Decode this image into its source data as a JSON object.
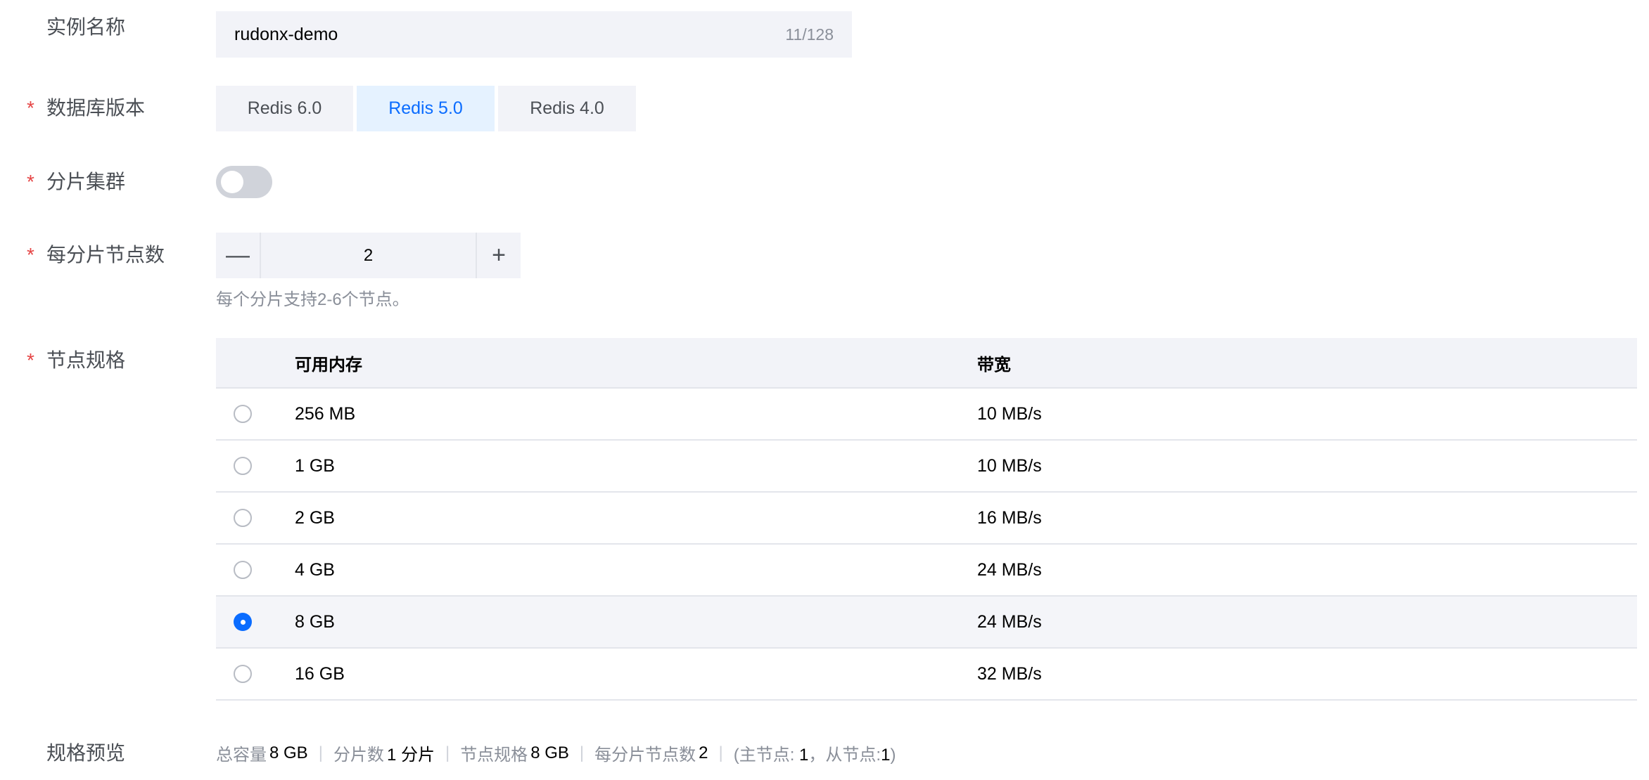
{
  "instance_name": {
    "label": "实例名称",
    "value": "rudonx-demo",
    "count": "11/128"
  },
  "db_version": {
    "label": "数据库版本",
    "options": [
      "Redis 6.0",
      "Redis 5.0",
      "Redis 4.0"
    ],
    "selected": "Redis 5.0"
  },
  "sharding": {
    "label": "分片集群",
    "enabled": false
  },
  "nodes_per_shard": {
    "label": "每分片节点数",
    "minus": "—",
    "plus": "+",
    "value": "2",
    "help": "每个分片支持2-6个节点。"
  },
  "node_spec": {
    "label": "节点规格",
    "columns": [
      "可用内存",
      "带宽"
    ],
    "rows": [
      {
        "memory": "256 MB",
        "bandwidth": "10 MB/s",
        "selected": false
      },
      {
        "memory": "1 GB",
        "bandwidth": "10 MB/s",
        "selected": false
      },
      {
        "memory": "2 GB",
        "bandwidth": "16 MB/s",
        "selected": false
      },
      {
        "memory": "4 GB",
        "bandwidth": "24 MB/s",
        "selected": false
      },
      {
        "memory": "8 GB",
        "bandwidth": "24 MB/s",
        "selected": true
      },
      {
        "memory": "16 GB",
        "bandwidth": "32 MB/s",
        "selected": false
      }
    ]
  },
  "preview": {
    "label": "规格预览",
    "total_label": "总容量",
    "total_value": "8 GB",
    "shards_label": "分片数",
    "shards_value": "1 分片",
    "spec_label": "节点规格",
    "spec_value": "8 GB",
    "nodes_label": "每分片节点数",
    "nodes_value": "2",
    "detail_open": "(主节点: ",
    "primary_value": "1",
    "detail_mid": "，从节点:",
    "replica_value": "1",
    "detail_close": ")",
    "separator": "|"
  },
  "required_mark": "*",
  "colors": {
    "accent": "#0a6cff",
    "required": "#e54545",
    "field_bg": "#f2f3f8",
    "selected_option_bg": "#e5f2ff"
  }
}
